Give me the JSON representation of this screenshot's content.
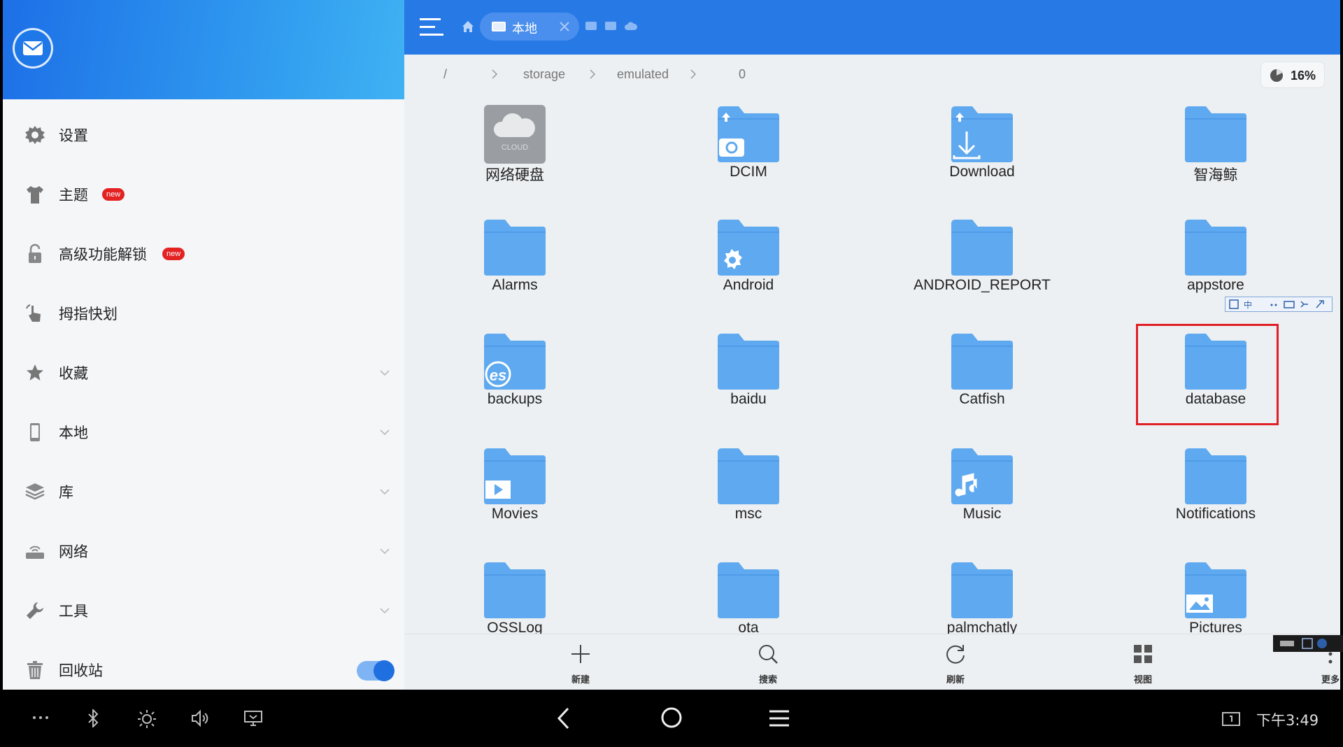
{
  "sidebar": {
    "items": [
      {
        "label": "设置",
        "icon": "gear-icon"
      },
      {
        "label": "主题",
        "icon": "tshirt-icon",
        "badge": "new"
      },
      {
        "label": "高级功能解锁",
        "icon": "unlock-icon",
        "badge": "new"
      },
      {
        "label": "拇指快划",
        "icon": "thumb-swipe-icon"
      },
      {
        "label": "收藏",
        "icon": "star-icon"
      },
      {
        "label": "本地",
        "icon": "phone-icon"
      },
      {
        "label": "库",
        "icon": "layers-icon"
      },
      {
        "label": "网络",
        "icon": "network-icon"
      },
      {
        "label": "工具",
        "icon": "wrench-icon"
      },
      {
        "label": "回收站",
        "icon": "trash-icon",
        "toggle_on": true
      }
    ]
  },
  "topbar": {
    "active_tab": "本地"
  },
  "breadcrumb": {
    "root": "/",
    "parts": [
      "storage",
      "emulated",
      "0"
    ],
    "storage_used": "16%"
  },
  "files": [
    {
      "name": "网络硬盘",
      "type": "cloud"
    },
    {
      "name": "DCIM",
      "type": "camera"
    },
    {
      "name": "Download",
      "type": "download"
    },
    {
      "name": "智海鲸",
      "type": "folder"
    },
    {
      "name": "Alarms",
      "type": "folder"
    },
    {
      "name": "Android",
      "type": "gear"
    },
    {
      "name": "ANDROID_REPORT",
      "type": "folder"
    },
    {
      "name": "appstore",
      "type": "folder"
    },
    {
      "name": "backups",
      "type": "es"
    },
    {
      "name": "baidu",
      "type": "folder"
    },
    {
      "name": "Catfish",
      "type": "folder"
    },
    {
      "name": "database",
      "type": "folder"
    },
    {
      "name": "Movies",
      "type": "movie"
    },
    {
      "name": "msc",
      "type": "folder"
    },
    {
      "name": "Music",
      "type": "music"
    },
    {
      "name": "Notifications",
      "type": "folder"
    },
    {
      "name": "OSSLog",
      "type": "folder"
    },
    {
      "name": "ota",
      "type": "folder"
    },
    {
      "name": "palmchatly",
      "type": "folder"
    },
    {
      "name": "Pictures",
      "type": "picture"
    }
  ],
  "toolbar": {
    "new_label": "新建",
    "search_label": "搜索",
    "refresh_label": "刷新",
    "view_label": "视图",
    "more_label": "更多"
  },
  "status": {
    "time": "下午3:49"
  },
  "colors": {
    "accent": "#2779e6",
    "folder": "#5ea9ef",
    "highlight": "#e01f26"
  }
}
